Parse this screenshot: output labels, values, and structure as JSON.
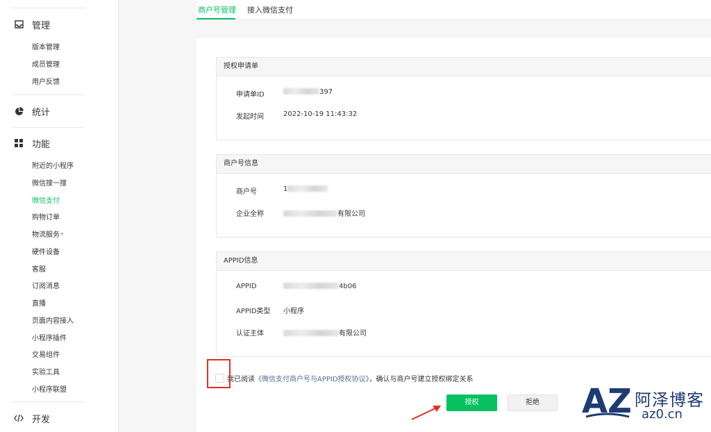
{
  "sidebar": {
    "sections": [
      {
        "title": "管理",
        "icon": "inbox-icon",
        "items": [
          "版本管理",
          "成员管理",
          "用户反馈"
        ]
      },
      {
        "title": "统计",
        "icon": "pie-chart-icon",
        "items": []
      },
      {
        "title": "功能",
        "icon": "grid-icon",
        "items": [
          "附近的小程序",
          "微信搜一搜",
          "微信支付",
          "购物订单",
          "物流服务",
          "硬件设备",
          "客服",
          "订阅消息",
          "直播",
          "页面内容接入",
          "小程序插件",
          "交易组件",
          "实验工具",
          "小程序联盟"
        ]
      },
      {
        "title": "开发",
        "icon": "code-icon",
        "items": []
      }
    ],
    "active_item": "微信支付",
    "badge_marker": "*"
  },
  "tabs": [
    "商户号管理",
    "接入微信支付"
  ],
  "cards": [
    {
      "title": "授权申请单",
      "rows": [
        {
          "label": "申请单ID",
          "value": "397"
        },
        {
          "label": "发起时间",
          "value": "2022-10-19 11:43:32"
        }
      ]
    },
    {
      "title": "商户号信息",
      "rows": [
        {
          "label": "商户号",
          "value": "1"
        },
        {
          "label": "企业全称",
          "value": "有限公司"
        }
      ]
    },
    {
      "title": "APPID信息",
      "rows": [
        {
          "label": "APPID",
          "value": "4b06"
        },
        {
          "label": "APPID类型",
          "value": "小程序"
        },
        {
          "label": "认证主体",
          "value": "有限公司"
        }
      ]
    }
  ],
  "agreement": {
    "prefix": "我已阅读",
    "link": "《微信支付商户号与APPID授权协议》",
    "suffix": "，确认与商户号建立授权绑定关系"
  },
  "buttons": {
    "authorize": "授权",
    "reject": "拒绝"
  },
  "watermark": {
    "logo": "AZ",
    "cn": "阿泽博客",
    "en": "az0.cn"
  },
  "colors": {
    "accent": "#07c160",
    "link": "#576b95",
    "highlight": "#e0301e",
    "watermark": "#1f3b73"
  }
}
